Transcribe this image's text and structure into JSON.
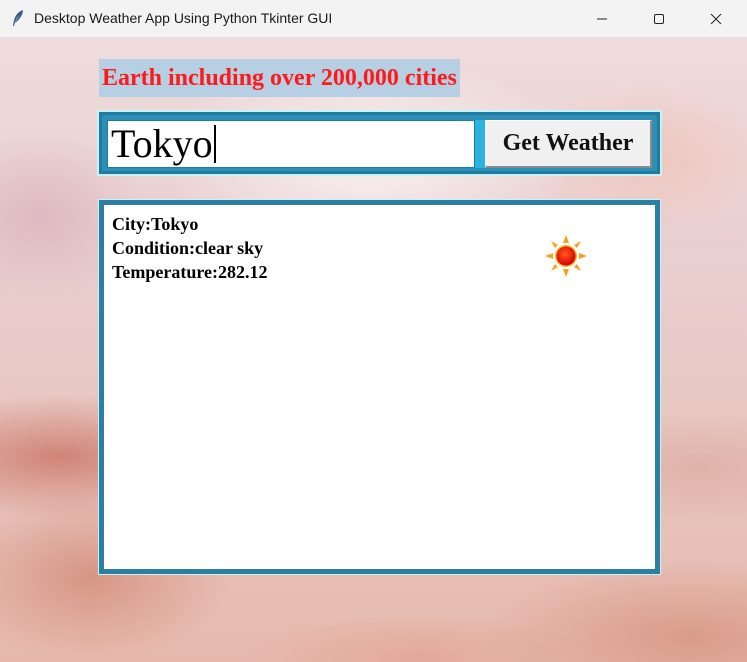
{
  "window": {
    "title": "Desktop Weather App Using Python Tkinter GUI",
    "app_icon": "feather-icon",
    "controls": [
      "minimize-icon",
      "maximize-icon",
      "close-icon"
    ]
  },
  "heading": {
    "text": "Earth including over 200,000 cities",
    "color": "#ff1a1a",
    "background": "#b7cfe2"
  },
  "search": {
    "city_value": "Tokyo",
    "button_label": "Get Weather"
  },
  "result": {
    "city_line": "City:Tokyo",
    "condition_line": "Condition:clear sky",
    "temperature_line": "Temperature:282.12",
    "weather_icon": "sun-icon"
  },
  "colors": {
    "frame": "#2a7fa3",
    "accent": "#2ab2e0"
  }
}
